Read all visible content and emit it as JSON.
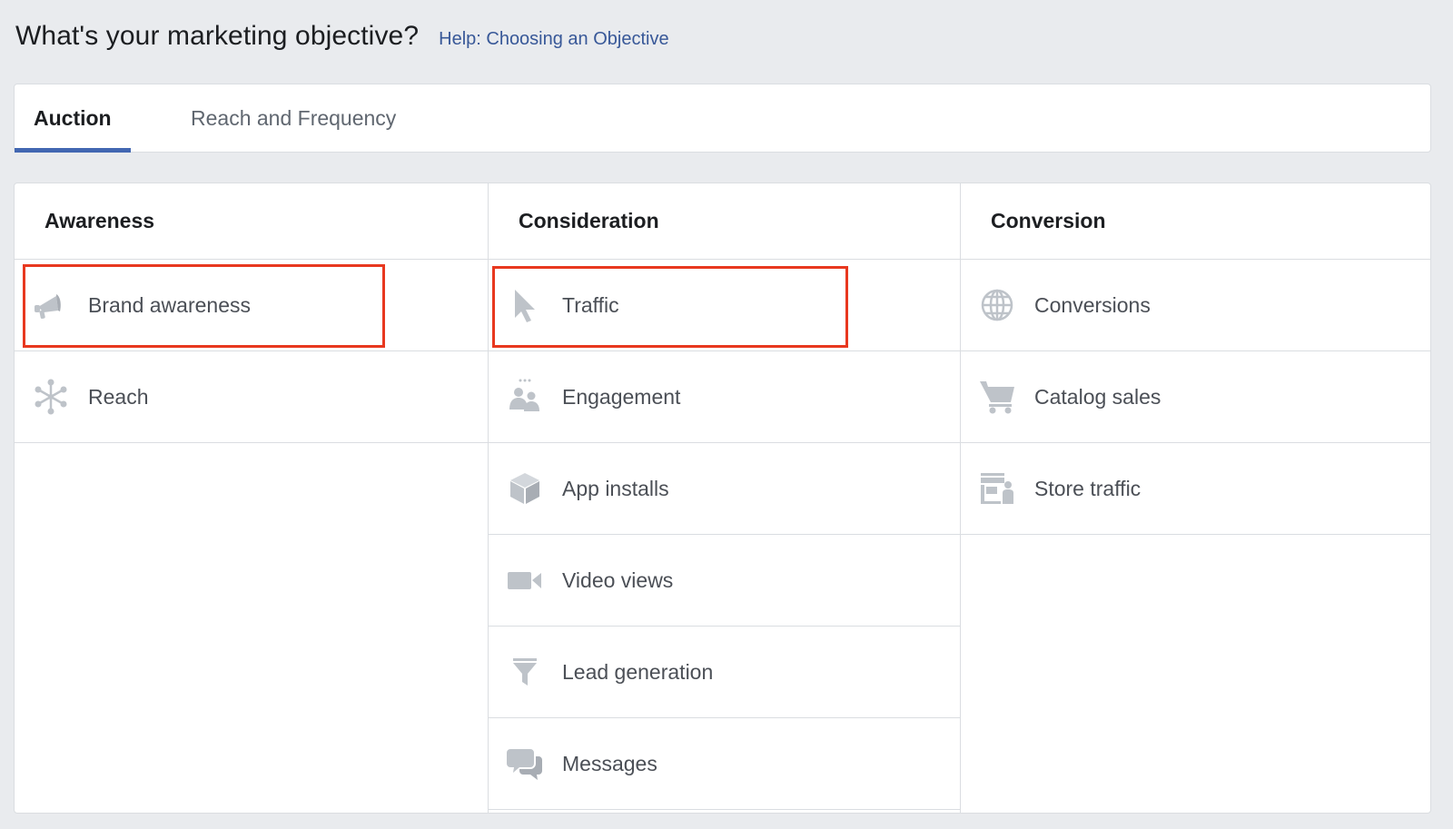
{
  "header": {
    "title": "What's your marketing objective?",
    "help_link": "Help: Choosing an Objective"
  },
  "tabs": [
    {
      "label": "Auction",
      "active": true
    },
    {
      "label": "Reach and Frequency",
      "active": false
    }
  ],
  "columns": [
    {
      "heading": "Awareness",
      "items": [
        {
          "label": "Brand awareness",
          "icon": "megaphone-icon",
          "highlighted": true
        },
        {
          "label": "Reach",
          "icon": "asterisk-network-icon"
        }
      ]
    },
    {
      "heading": "Consideration",
      "items": [
        {
          "label": "Traffic",
          "icon": "cursor-icon",
          "highlighted": true
        },
        {
          "label": "Engagement",
          "icon": "people-icon"
        },
        {
          "label": "App installs",
          "icon": "cube-icon"
        },
        {
          "label": "Video views",
          "icon": "video-camera-icon"
        },
        {
          "label": "Lead generation",
          "icon": "funnel-icon"
        },
        {
          "label": "Messages",
          "icon": "chat-bubbles-icon"
        }
      ]
    },
    {
      "heading": "Conversion",
      "items": [
        {
          "label": "Conversions",
          "icon": "globe-icon"
        },
        {
          "label": "Catalog sales",
          "icon": "shopping-cart-icon"
        },
        {
          "label": "Store traffic",
          "icon": "storefront-person-icon"
        }
      ]
    }
  ],
  "colors": {
    "background": "#e9ebee",
    "accent": "#4267b2",
    "link": "#385898",
    "highlight_box": "#e8381f",
    "icon": "#bec3c9"
  }
}
